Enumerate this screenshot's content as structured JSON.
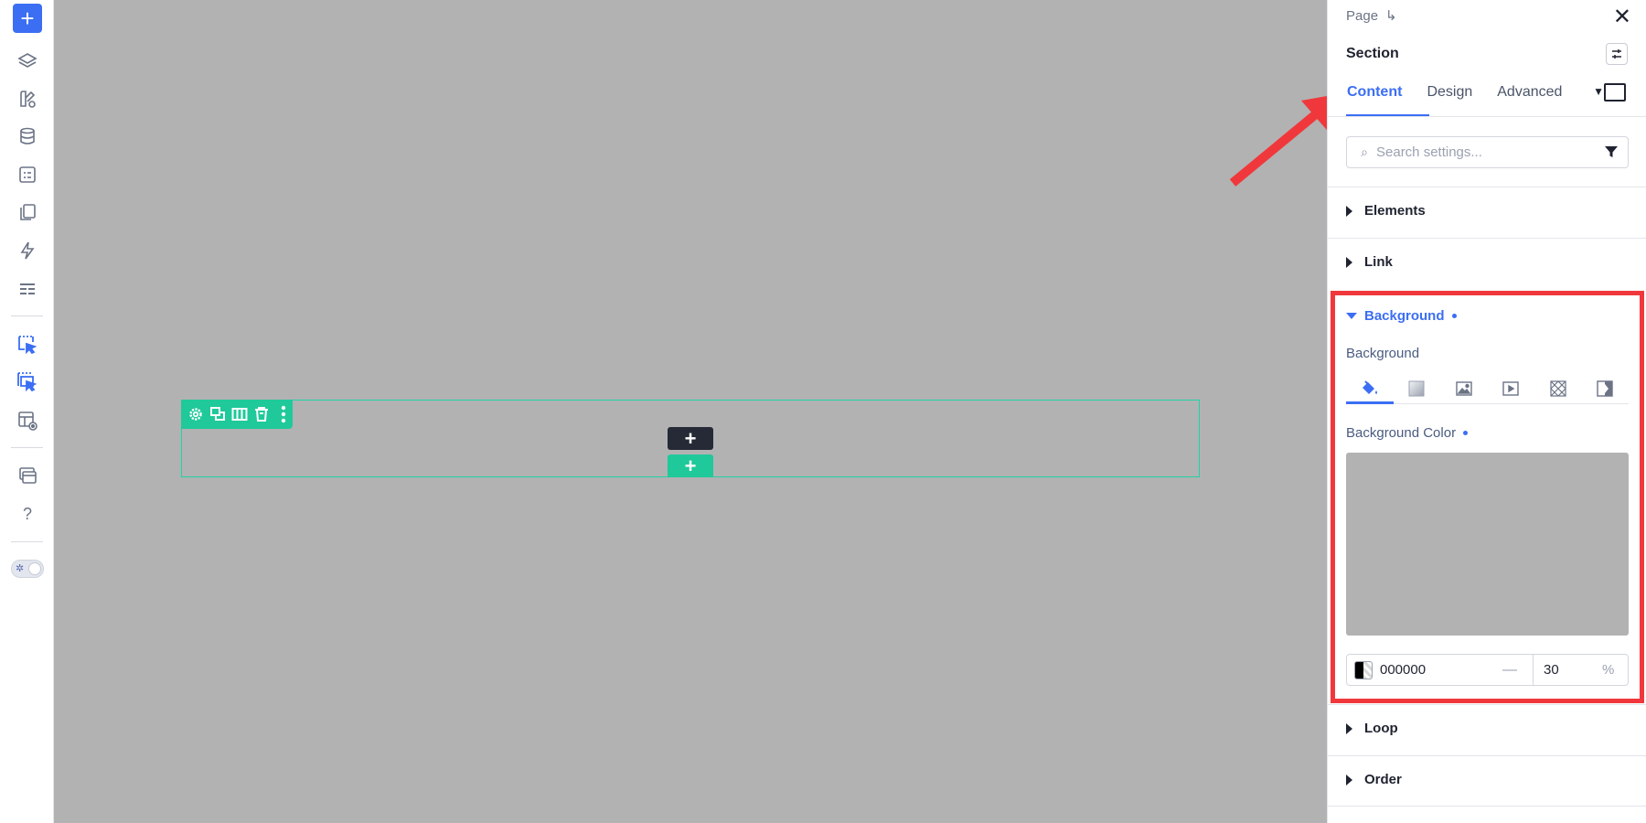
{
  "rail": {
    "add_label": "+",
    "help_label": "?",
    "icons": [
      "add-icon",
      "layers-icon",
      "brush-icon",
      "database-icon",
      "form-icon",
      "pages-icon",
      "lightning-icon",
      "sections-icon",
      "select-element-icon",
      "select-elements-icon",
      "preview-icon",
      "templates-icon",
      "help-icon",
      "theme-toggle-icon"
    ]
  },
  "canvas": {
    "background": "#b2b2b2",
    "accent": "#1fc99a",
    "add_dark_label": "+",
    "add_green_label": "+"
  },
  "panel": {
    "breadcrumb": "Page",
    "breadcrumb_icon": "↳",
    "close_label": "✕",
    "title": "Section",
    "tabs": [
      {
        "label": "Content",
        "active": true
      },
      {
        "label": "Design",
        "active": false
      },
      {
        "label": "Advanced",
        "active": false
      }
    ],
    "search_placeholder": "Search settings...",
    "sections": {
      "elements": "Elements",
      "link": "Link",
      "background": "Background",
      "loop": "Loop",
      "order": "Order"
    },
    "background": {
      "field_label": "Background",
      "types": [
        "paint-bucket-icon",
        "gradient-icon",
        "image-icon",
        "video-icon",
        "pattern-icon",
        "overlay-icon"
      ],
      "color_label": "Background Color",
      "hex": "000000",
      "dash": "—",
      "opacity": "30",
      "unit": "%"
    },
    "accent": "#3b6ef3"
  }
}
